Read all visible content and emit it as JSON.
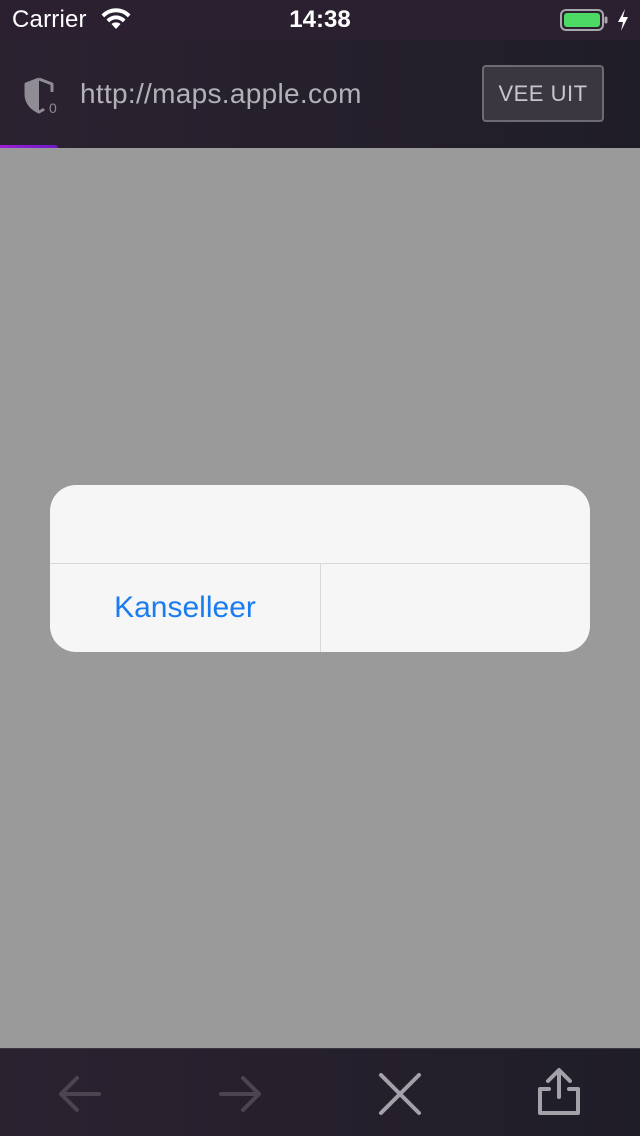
{
  "status_bar": {
    "carrier": "Carrier",
    "time": "14:38",
    "battery_color": "#4cd964"
  },
  "url_bar": {
    "url": "http://maps.apple.com",
    "tracking_count": "0",
    "erase_button_label": "VEE UIT"
  },
  "page_load_progress": 0.09,
  "alert": {
    "cancel_label": "Kanselleer",
    "accent_color": "#1a7cf0"
  },
  "toolbar": {
    "icons": [
      "back-arrow-icon",
      "forward-arrow-icon",
      "close-icon",
      "share-icon"
    ]
  }
}
